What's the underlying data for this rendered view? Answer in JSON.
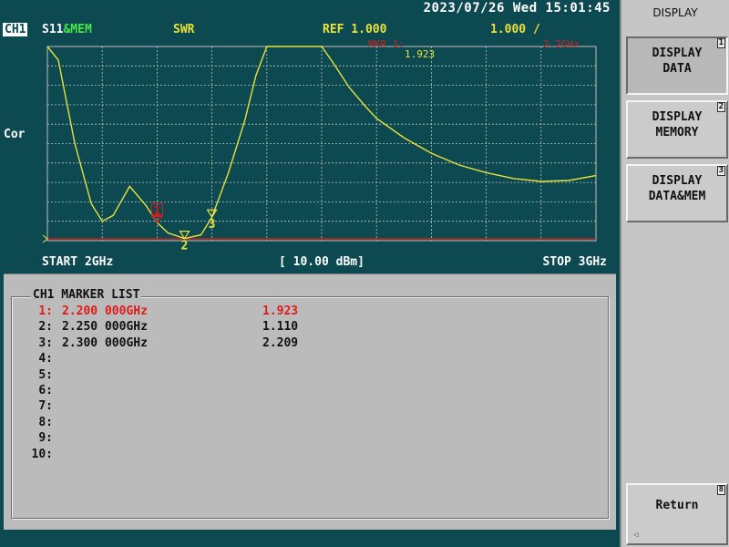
{
  "header": {
    "datetime": "2023/07/26 Wed 15:01:45"
  },
  "channel": {
    "label": "CH1",
    "parameter": "S11",
    "display_mode": "&MEM",
    "format": "SWR",
    "ref_text": "REF  1.000",
    "scale_text": "1.000 /",
    "correction": "Cor",
    "marker_text": "MKR  1:",
    "marker_freq": "2.2GHz",
    "marker_value": "1.923",
    "start": "START 2GHz",
    "power": "[ 10.00 dBm]",
    "stop": "STOP 3GHz"
  },
  "colors": {
    "background": "#0c4950",
    "trace": "#e8e23a",
    "grid": "#c0c0c0",
    "reference_line": "#d02020",
    "active_marker": "#e01a1a"
  },
  "chart_data": {
    "type": "line",
    "x_range": [
      2.0,
      3.0
    ],
    "x_unit": "GHz",
    "y_range": [
      1.0,
      11.0
    ],
    "reference_value": 1.0,
    "grid": true,
    "series": [
      {
        "x": [
          2.0,
          2.02,
          2.05,
          2.08,
          2.1,
          2.12,
          2.15,
          2.18,
          2.2,
          2.22,
          2.25,
          2.28,
          2.3,
          2.33,
          2.36,
          2.38,
          2.4,
          2.42,
          2.44,
          2.5,
          2.52,
          2.55,
          2.58,
          2.6,
          2.65,
          2.7,
          2.75,
          2.8,
          2.85,
          2.9,
          2.95,
          3.0
        ],
        "y": [
          11.0,
          10.3,
          6.0,
          2.9,
          2.0,
          2.3,
          3.8,
          2.8,
          1.923,
          1.4,
          1.11,
          1.3,
          2.209,
          4.5,
          7.2,
          9.5,
          11.0,
          11.0,
          11.0,
          11.0,
          10.2,
          8.9,
          7.9,
          7.3,
          6.3,
          5.5,
          4.9,
          4.5,
          4.2,
          4.05,
          4.1,
          4.35
        ]
      }
    ],
    "markers": [
      {
        "id": "1",
        "x": 2.2,
        "y": 1.923,
        "active": true
      },
      {
        "id": "2",
        "x": 2.25,
        "y": 1.11,
        "active": false
      },
      {
        "id": "3",
        "x": 2.3,
        "y": 2.209,
        "active": false
      }
    ]
  },
  "marker_list": {
    "title": "CH1 MARKER LIST",
    "rows": [
      {
        "num": "1:",
        "freq": "2.200 000GHz",
        "value": "1.923"
      },
      {
        "num": "2:",
        "freq": "2.250 000GHz",
        "value": "1.110"
      },
      {
        "num": "3:",
        "freq": "2.300 000GHz",
        "value": "2.209"
      },
      {
        "num": "4:",
        "freq": "",
        "value": ""
      },
      {
        "num": "5:",
        "freq": "",
        "value": ""
      },
      {
        "num": "6:",
        "freq": "",
        "value": ""
      },
      {
        "num": "7:",
        "freq": "",
        "value": ""
      },
      {
        "num": "8:",
        "freq": "",
        "value": ""
      },
      {
        "num": "9:",
        "freq": "",
        "value": ""
      },
      {
        "num": "10:",
        "freq": "",
        "value": ""
      }
    ]
  },
  "menu": {
    "title": "DISPLAY",
    "keys": [
      {
        "label": "DISPLAY\nDATA",
        "num": "1"
      },
      {
        "label": "DISPLAY\nMEMORY",
        "num": "2"
      },
      {
        "label": "DISPLAY\nDATA&MEM",
        "num": "3"
      },
      {
        "label": "Return",
        "num": "8"
      }
    ],
    "return_arrow": "◁"
  }
}
